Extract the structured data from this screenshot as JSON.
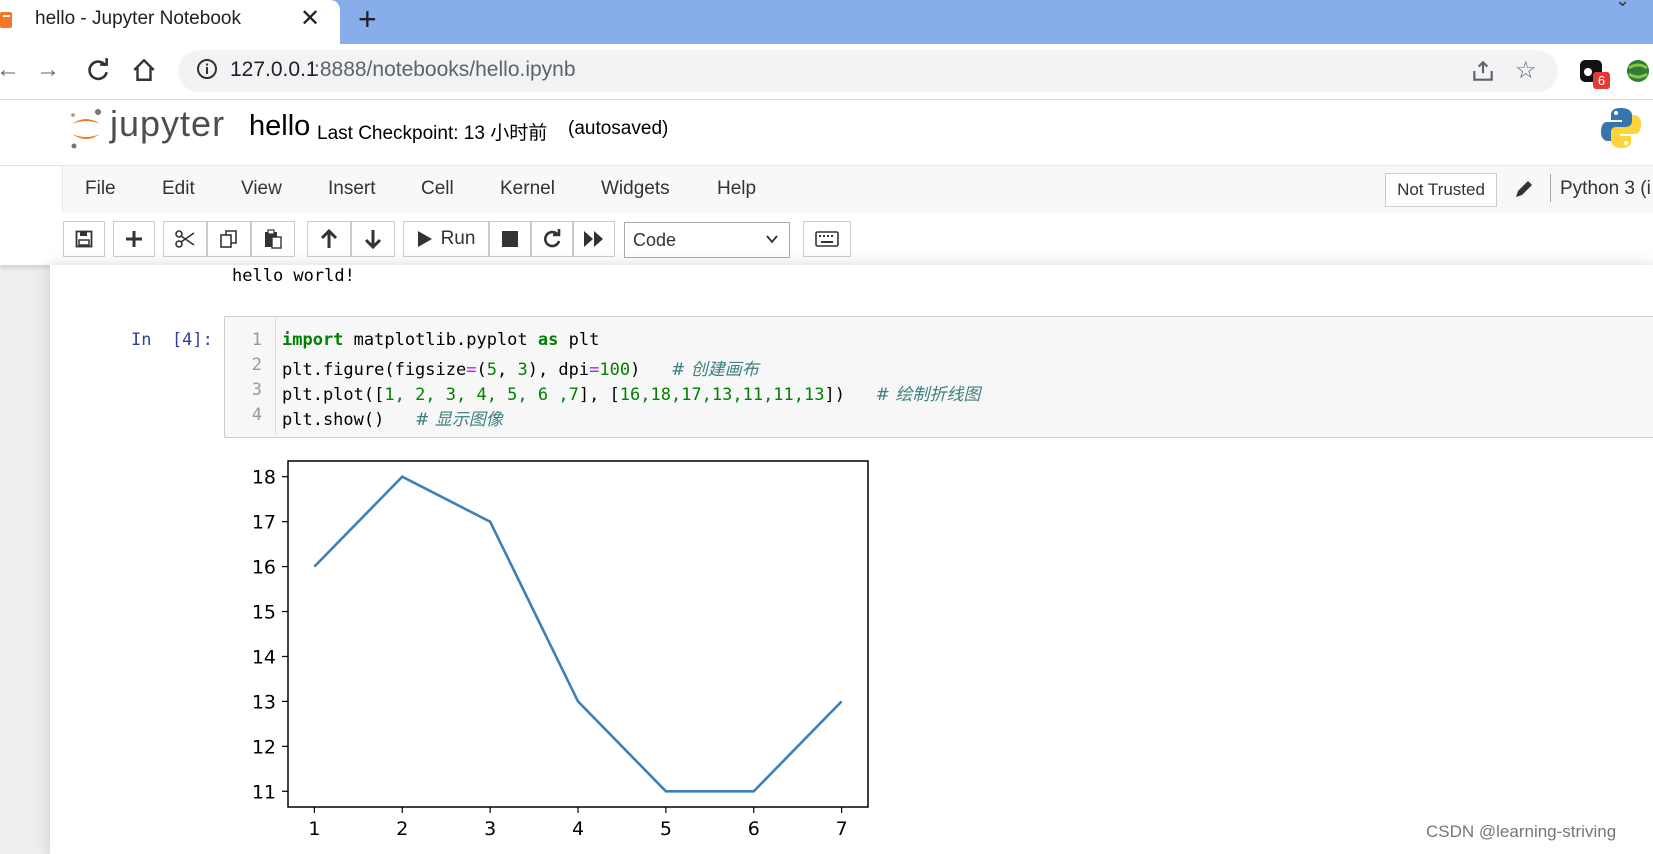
{
  "browser": {
    "tab_title": "hello - Jupyter Notebook",
    "tab_close": "✕",
    "new_tab": "+",
    "url_host": "127.0.0.1",
    "url_rest": ":8888/notebooks/hello.ipynb",
    "ext_badge": "6"
  },
  "jupyter": {
    "logo_text": "jupyter",
    "notebook_name": "hello",
    "checkpoint": "Last Checkpoint: 13 小时前",
    "autosaved": "(autosaved)"
  },
  "menubar": {
    "items": [
      "File",
      "Edit",
      "View",
      "Insert",
      "Cell",
      "Kernel",
      "Widgets",
      "Help"
    ],
    "not_trusted": "Not Trusted",
    "kernel": "Python 3 (i"
  },
  "toolbar": {
    "run_label": "Run",
    "cell_type": "Code"
  },
  "notebook": {
    "prev_output": "hello world!",
    "prompt": "In  [4]:",
    "line_numbers": [
      "1",
      "2",
      "3",
      "4"
    ],
    "code": {
      "l1_kw1": "import",
      "l1_mod": " matplotlib.pyplot ",
      "l1_kw2": "as",
      "l1_alias": " plt",
      "l2_a": "plt.figure(figsize",
      "l2_eq1": "=",
      "l2_b": "(",
      "l2_n1": "5",
      "l2_c": ", ",
      "l2_n2": "3",
      "l2_d": "), dpi",
      "l2_eq2": "=",
      "l2_n3": "100",
      "l2_e": ")   ",
      "l2_cmt": "# 创建画布",
      "l3_a": "plt.plot([",
      "l3_nums1": "1, 2, 3, 4, 5, 6 ,7",
      "l3_b": "], [",
      "l3_nums2": "16,18,17,13,11,11,13",
      "l3_c": "])   ",
      "l3_cmt": "# 绘制折线图",
      "l4_a": "plt.show()   ",
      "l4_cmt": "# 显示图像"
    }
  },
  "chart_data": {
    "type": "line",
    "x": [
      1,
      2,
      3,
      4,
      5,
      6,
      7
    ],
    "series": [
      {
        "values": [
          16,
          18,
          17,
          13,
          11,
          11,
          13
        ],
        "color": "#3b80b8"
      }
    ],
    "xticks": [
      1,
      2,
      3,
      4,
      5,
      6,
      7
    ],
    "yticks": [
      11,
      12,
      13,
      14,
      15,
      16,
      17,
      18
    ],
    "xlim": [
      0.7,
      7.3
    ],
    "ylim": [
      10.65,
      18.35
    ],
    "grid": false
  },
  "watermark": "CSDN @learning-striving"
}
